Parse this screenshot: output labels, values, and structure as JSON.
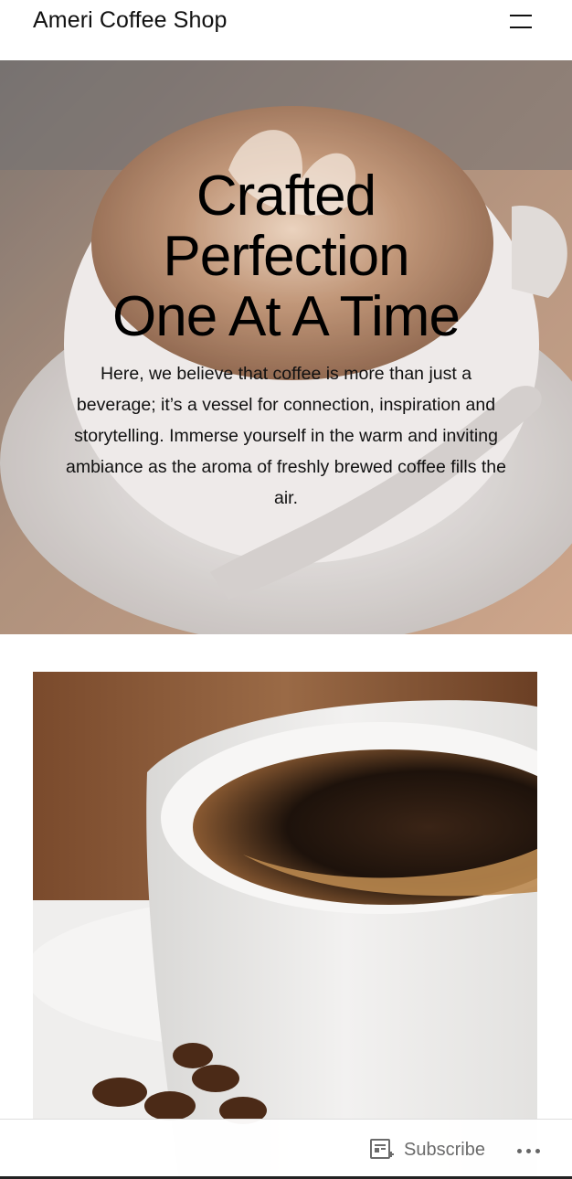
{
  "header": {
    "site_title": "Ameri Coffee Shop",
    "menu_icon": "hamburger-menu-icon"
  },
  "hero": {
    "title_line1": "Crafted",
    "title_line2": "Perfection",
    "title_line3": "One At A Time",
    "description": "Here, we believe that coffee is more than just a beverage; it’s a vessel for connection, inspiration and storytelling. Immerse yourself in the warm and inviting ambiance as the aroma of freshly brewed coffee fills the air."
  },
  "bottom_bar": {
    "subscribe_label": "Subscribe",
    "subscribe_icon": "reader-subscribe-icon",
    "more_icon": "ellipsis-icon"
  },
  "colors": {
    "text": "#111111",
    "muted": "#6b6b6b"
  }
}
